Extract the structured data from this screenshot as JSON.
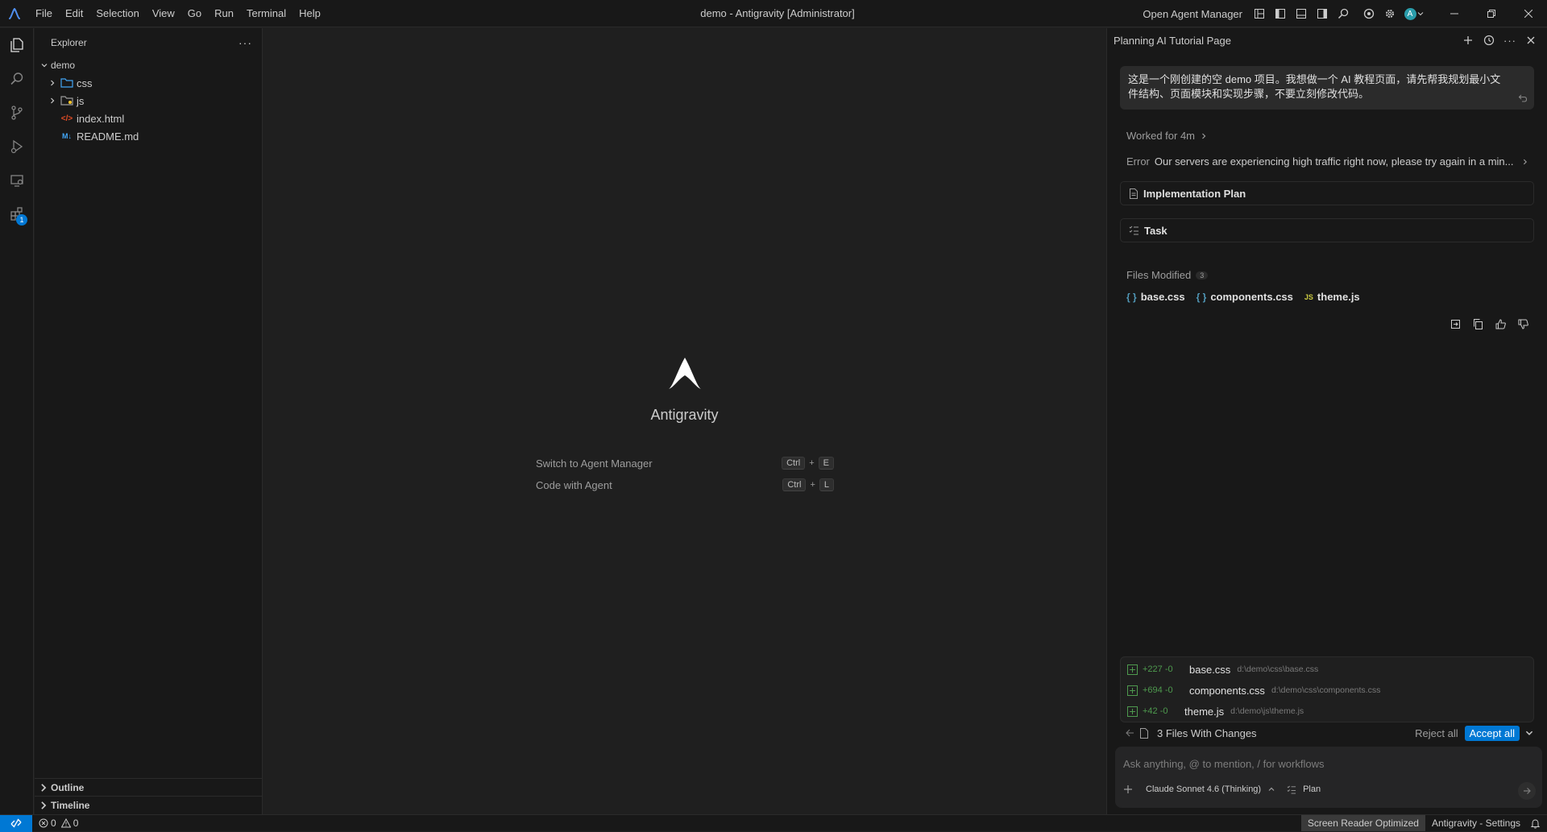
{
  "titlebar": {
    "menu": [
      "File",
      "Edit",
      "Selection",
      "View",
      "Go",
      "Run",
      "Terminal",
      "Help"
    ],
    "window_title": "demo - Antigravity [Administrator]",
    "open_agent_manager": "Open Agent Manager",
    "avatar_letter": "A"
  },
  "sidebar": {
    "title": "Explorer",
    "root": "demo",
    "items": [
      {
        "label": "css",
        "type": "folder",
        "icon": "folder-css-icon"
      },
      {
        "label": "js",
        "type": "folder",
        "icon": "folder-js-icon"
      },
      {
        "label": "index.html",
        "type": "file",
        "icon": "html-file-icon"
      },
      {
        "label": "README.md",
        "type": "file",
        "icon": "markdown-file-icon"
      }
    ],
    "outline": "Outline",
    "timeline": "Timeline",
    "extensions_badge": "1"
  },
  "editor": {
    "brand": "Antigravity",
    "shortcuts": [
      {
        "label": "Switch to Agent Manager",
        "keys": [
          "Ctrl",
          "E"
        ]
      },
      {
        "label": "Code with Agent",
        "keys": [
          "Ctrl",
          "L"
        ]
      }
    ]
  },
  "agent": {
    "title": "Planning AI Tutorial Page",
    "user_message_line1": "这是一个刚创建的空 demo 项目。我想做一个 AI 教程页面，请先帮我规划最小文",
    "user_message_line2": "件结构、页面模块和实现步骤，不要立刻修改代码。",
    "worked_for": "Worked for 4m",
    "error_label": "Error",
    "error_text": "Our servers are experiencing high traffic right now, please try again in a min...",
    "implementation_plan": "Implementation Plan",
    "task": "Task",
    "files_modified_label": "Files Modified",
    "files_modified_count": "3",
    "files_modified": [
      {
        "name": "base.css",
        "icon": "css-icon",
        "glyph": "{ }"
      },
      {
        "name": "components.css",
        "icon": "css-icon",
        "glyph": "{ }"
      },
      {
        "name": "theme.js",
        "icon": "js-icon",
        "glyph": "JS"
      }
    ],
    "changes": [
      {
        "stat": "+227 -0",
        "name": "base.css",
        "path": "d:\\demo\\css\\base.css"
      },
      {
        "stat": "+694 -0",
        "name": "components.css",
        "path": "d:\\demo\\css\\components.css"
      },
      {
        "stat": "+42 -0",
        "name": "theme.js",
        "path": "d:\\demo\\js\\theme.js"
      }
    ],
    "changes_summary": "3 Files With Changes",
    "reject_all": "Reject all",
    "accept_all": "Accept all",
    "input_placeholder": "Ask anything, @ to mention, / for workflows",
    "model": "Claude Sonnet 4.6 (Thinking)",
    "mode": "Plan"
  },
  "statusbar": {
    "errors": "0",
    "warnings": "0",
    "screen_reader": "Screen Reader Optimized",
    "settings": "Antigravity - Settings"
  },
  "colors": {
    "accent": "#0078d4",
    "background": "#1f1f1f",
    "panel": "#181818",
    "added": "#4e9a4e"
  }
}
